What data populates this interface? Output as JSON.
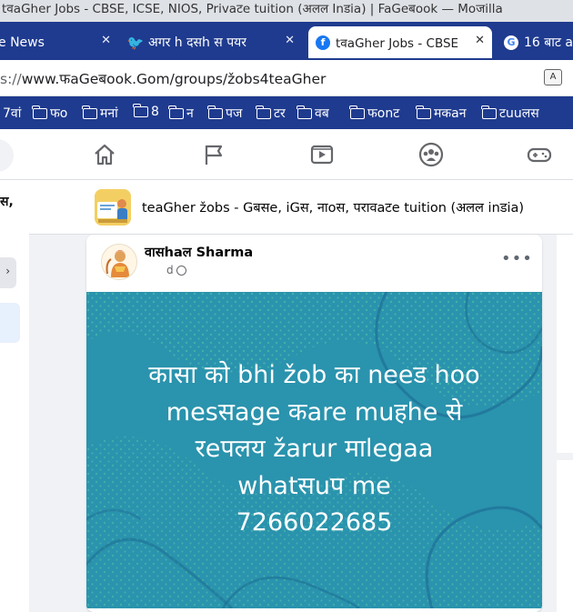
{
  "window": {
    "title": "tवaGher Jobs - CBSE, ICSE, NIOS, Privaटe tuition (अलल Inडia) | FaGeबook — Moजilla"
  },
  "tabs": [
    {
      "label": "e News",
      "active": false
    },
    {
      "label": "अगर h दसh स पयर",
      "active": false
    },
    {
      "label": "tवaGher Jobs - CBSE",
      "active": true
    },
    {
      "label": "16 बाट a",
      "active": false
    }
  ],
  "address": {
    "scheme": "s://",
    "url": "www.फaGeबook.Gom/groups/žobs4teaGher",
    "translate_icon": "translate-icon"
  },
  "bookmarks": [
    "7वां",
    "फo",
    "मनां",
    "8",
    "न",
    "पज",
    "टर",
    "वब",
    "फonट",
    "मकaन",
    "टuuलस"
  ],
  "nav": {
    "icons": [
      "home-icon",
      "flag-icon",
      "video-icon",
      "groups-icon",
      "gaming-icon"
    ]
  },
  "left": {
    "snippet": "स,",
    "button_glyph": "›"
  },
  "group": {
    "title": "teaGher žobs - Gबसe, iGस, नाoस, परावaटe tuition (अलल inडia)"
  },
  "post": {
    "author": "वासhaल Sharma",
    "time": "d",
    "more_label": "•••",
    "text": "कासा को bhi žob का neeड hoo\nmesसage कare muहhe से\nरeपलय žarur माlegaa\nwhatसuप me\n7266022685"
  },
  "colors": {
    "browser_blue": "#1f3b8f",
    "post_bg": "#2a93ad",
    "fb_bg": "#f0f2f5"
  }
}
